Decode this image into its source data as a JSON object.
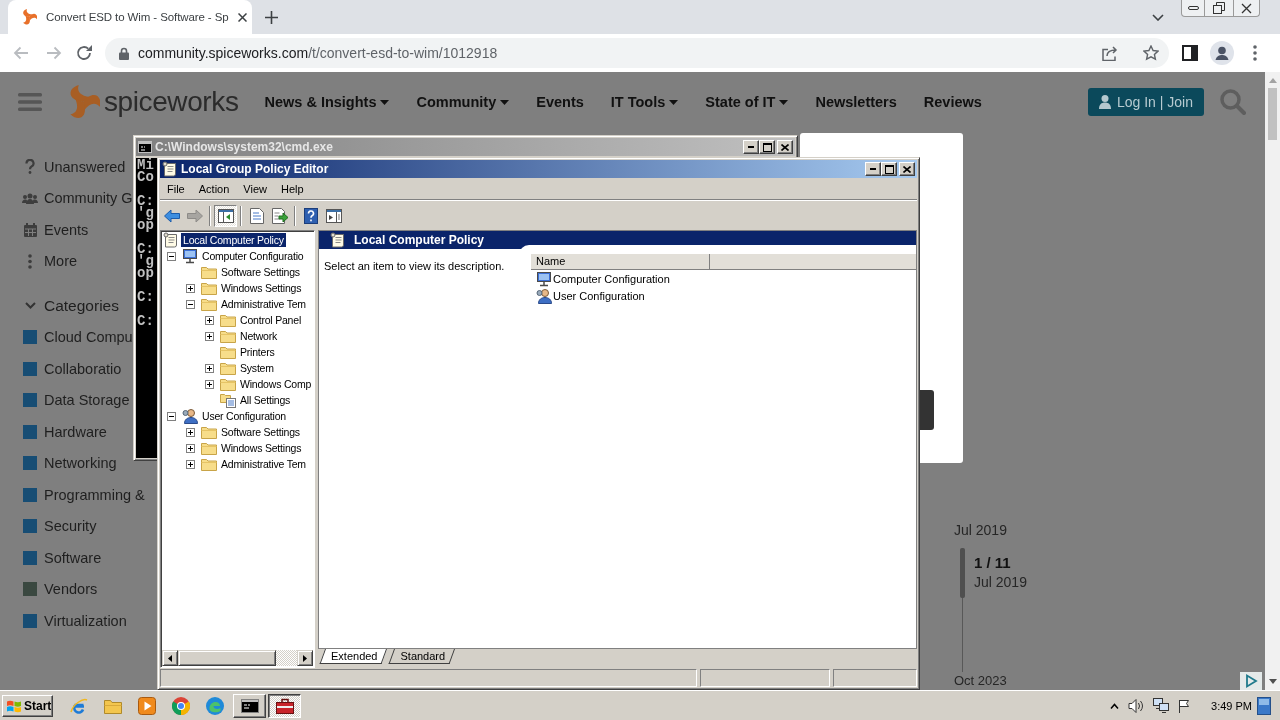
{
  "browser": {
    "tabs": [
      {
        "title": "Convert ESD to Wim - Software - Sp",
        "selected": true
      }
    ],
    "address": {
      "host": "community.spiceworks.com",
      "path": "/t/convert-esd-to-wim/1012918"
    }
  },
  "page": {
    "logo": "spiceworks",
    "nav": [
      {
        "label": "News & Insights",
        "dropdown": true
      },
      {
        "label": "Community",
        "dropdown": true
      },
      {
        "label": "Events",
        "dropdown": false
      },
      {
        "label": "IT Tools",
        "dropdown": true
      },
      {
        "label": "State of IT",
        "dropdown": true
      },
      {
        "label": "Newsletters",
        "dropdown": false
      },
      {
        "label": "Reviews",
        "dropdown": false
      }
    ],
    "login": "Log In | Join",
    "sidebar": {
      "links": [
        {
          "kind": "question",
          "label": "Unanswered"
        },
        {
          "kind": "people",
          "label": "Community G"
        },
        {
          "kind": "calendar",
          "label": "Events"
        },
        {
          "kind": "more",
          "label": "More"
        }
      ],
      "categories": {
        "label": "Categories",
        "expanded": true,
        "items": [
          {
            "label": "Cloud Compu",
            "color": "#174d74"
          },
          {
            "label": "Collaboratio",
            "color": "#174d74"
          },
          {
            "label": "Data Storage",
            "color": "#174d74"
          },
          {
            "label": "Hardware",
            "color": "#174d74"
          },
          {
            "label": "Networking",
            "color": "#174d74"
          },
          {
            "label": "Programming &",
            "color": "#174d74"
          },
          {
            "label": "Security",
            "color": "#174d74"
          },
          {
            "label": "Software",
            "color": "#174d74"
          },
          {
            "label": "Vendors",
            "color": "#3a4840"
          },
          {
            "label": "Virtualization",
            "color": "#174d74"
          }
        ]
      }
    },
    "timeline": {
      "start": "Jul 2019",
      "position": "1 / 11",
      "current": "Jul 2019",
      "end": "Oct 2023"
    }
  },
  "cmd_window": {
    "title": "C:\\Windows\\system32\\cmd.exe",
    "output": [
      [
        "Mi",
        "Co"
      ],
      [
        "C:",
        "'g",
        "op"
      ],
      [
        "C:",
        "'g",
        "op"
      ],
      [
        "C:"
      ],
      [
        "C:"
      ]
    ]
  },
  "policy_editor": {
    "title": "Local Group Policy Editor",
    "menu": [
      "File",
      "Action",
      "View",
      "Help"
    ],
    "toolbar": [
      [
        {
          "kind": "back",
          "disabled": false,
          "pressed": false
        },
        {
          "kind": "forward",
          "disabled": true,
          "pressed": false
        }
      ],
      [
        {
          "kind": "tree",
          "disabled": false,
          "pressed": true
        }
      ],
      [
        {
          "kind": "properties",
          "disabled": false,
          "pressed": false
        },
        {
          "kind": "export",
          "disabled": false,
          "pressed": false
        }
      ],
      [
        {
          "kind": "help",
          "disabled": false,
          "pressed": false
        },
        {
          "kind": "action-pane",
          "disabled": false,
          "pressed": false
        }
      ]
    ],
    "tree": [
      {
        "label": "Local Computer Policy",
        "kind": "policy",
        "selected": true,
        "expandable": false,
        "children": [
          {
            "label": "Computer Configuratio",
            "kind": "computer",
            "selected": false,
            "expanded": true,
            "children": [
              {
                "label": "Software Settings",
                "kind": "folder",
                "selected": false,
                "expandable": false
              },
              {
                "label": "Windows Settings",
                "kind": "folder",
                "selected": false,
                "expanded": false
              },
              {
                "label": "Administrative Tem",
                "kind": "folder",
                "selected": false,
                "expanded": true,
                "children": [
                  {
                    "label": "Control Panel",
                    "kind": "folder",
                    "selected": false,
                    "expanded": false
                  },
                  {
                    "label": "Network",
                    "kind": "folder",
                    "selected": false,
                    "expanded": false
                  },
                  {
                    "label": "Printers",
                    "kind": "folder",
                    "selected": false,
                    "expandable": false
                  },
                  {
                    "label": "System",
                    "kind": "folder",
                    "selected": false,
                    "expanded": false
                  },
                  {
                    "label": "Windows Comp",
                    "kind": "folder",
                    "selected": false,
                    "expanded": false
                  },
                  {
                    "label": "All Settings",
                    "kind": "all-settings",
                    "selected": false,
                    "expandable": false
                  }
                ]
              }
            ]
          },
          {
            "label": "User Configuration",
            "kind": "user",
            "selected": false,
            "expanded": true,
            "children": [
              {
                "label": "Software Settings",
                "kind": "folder",
                "selected": false,
                "expanded": false
              },
              {
                "label": "Windows Settings",
                "kind": "folder",
                "selected": false,
                "expanded": false
              },
              {
                "label": "Administrative Tem",
                "kind": "folder",
                "selected": false,
                "expanded": false
              }
            ]
          }
        ]
      }
    ],
    "panel": {
      "title": "Local Computer Policy",
      "description": "Select an item to view its description.",
      "columns": [
        "Name"
      ],
      "rows": [
        {
          "kind": "computer",
          "name": "Computer Configuration"
        },
        {
          "kind": "user",
          "name": "User Configuration"
        }
      ]
    },
    "view_tabs": [
      {
        "label": "Extended",
        "selected": true
      },
      {
        "label": "Standard",
        "selected": false
      }
    ]
  },
  "taskbar": {
    "start": "Start",
    "windows": [
      {
        "kind": "console",
        "selected": false
      },
      {
        "kind": "policy",
        "selected": true
      }
    ],
    "clock": "3:49 PM"
  }
}
